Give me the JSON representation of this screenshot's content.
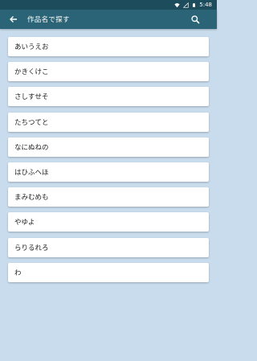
{
  "status_bar": {
    "time": "5:48",
    "icons": [
      "wifi-icon",
      "signal-icon",
      "battery-icon"
    ]
  },
  "toolbar": {
    "title": "作品名で探す",
    "back_icon": "arrow-left-icon",
    "search_icon": "search-icon"
  },
  "colors": {
    "status_bar": "#1d4d5c",
    "toolbar": "#2a6476",
    "background": "#c9dced"
  },
  "kana_rows": [
    {
      "label": "あいうえお"
    },
    {
      "label": "かきくけこ"
    },
    {
      "label": "さしすせそ"
    },
    {
      "label": "たちつてと"
    },
    {
      "label": "なにぬねの"
    },
    {
      "label": "はひふへほ"
    },
    {
      "label": "まみむめも"
    },
    {
      "label": "やゆよ"
    },
    {
      "label": "らりるれろ"
    },
    {
      "label": "わ"
    }
  ]
}
